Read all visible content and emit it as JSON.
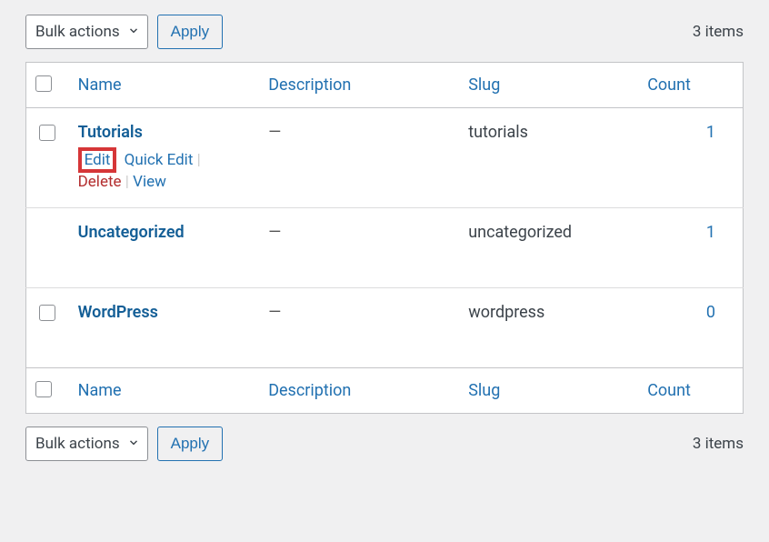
{
  "bulk": {
    "label": "Bulk actions",
    "apply": "Apply"
  },
  "items_text": "3 items",
  "headers": {
    "name": "Name",
    "desc": "Description",
    "slug": "Slug",
    "count": "Count"
  },
  "rows": [
    {
      "title": "Tutorials",
      "desc": "—",
      "slug": "tutorials",
      "count": "1"
    },
    {
      "title": "Uncategorized",
      "desc": "—",
      "slug": "uncategorized",
      "count": "1"
    },
    {
      "title": "WordPress",
      "desc": "—",
      "slug": "wordpress",
      "count": "0"
    }
  ],
  "actions": {
    "edit": "Edit",
    "qedit": "Quick Edit",
    "del": "Delete",
    "view": "View"
  }
}
